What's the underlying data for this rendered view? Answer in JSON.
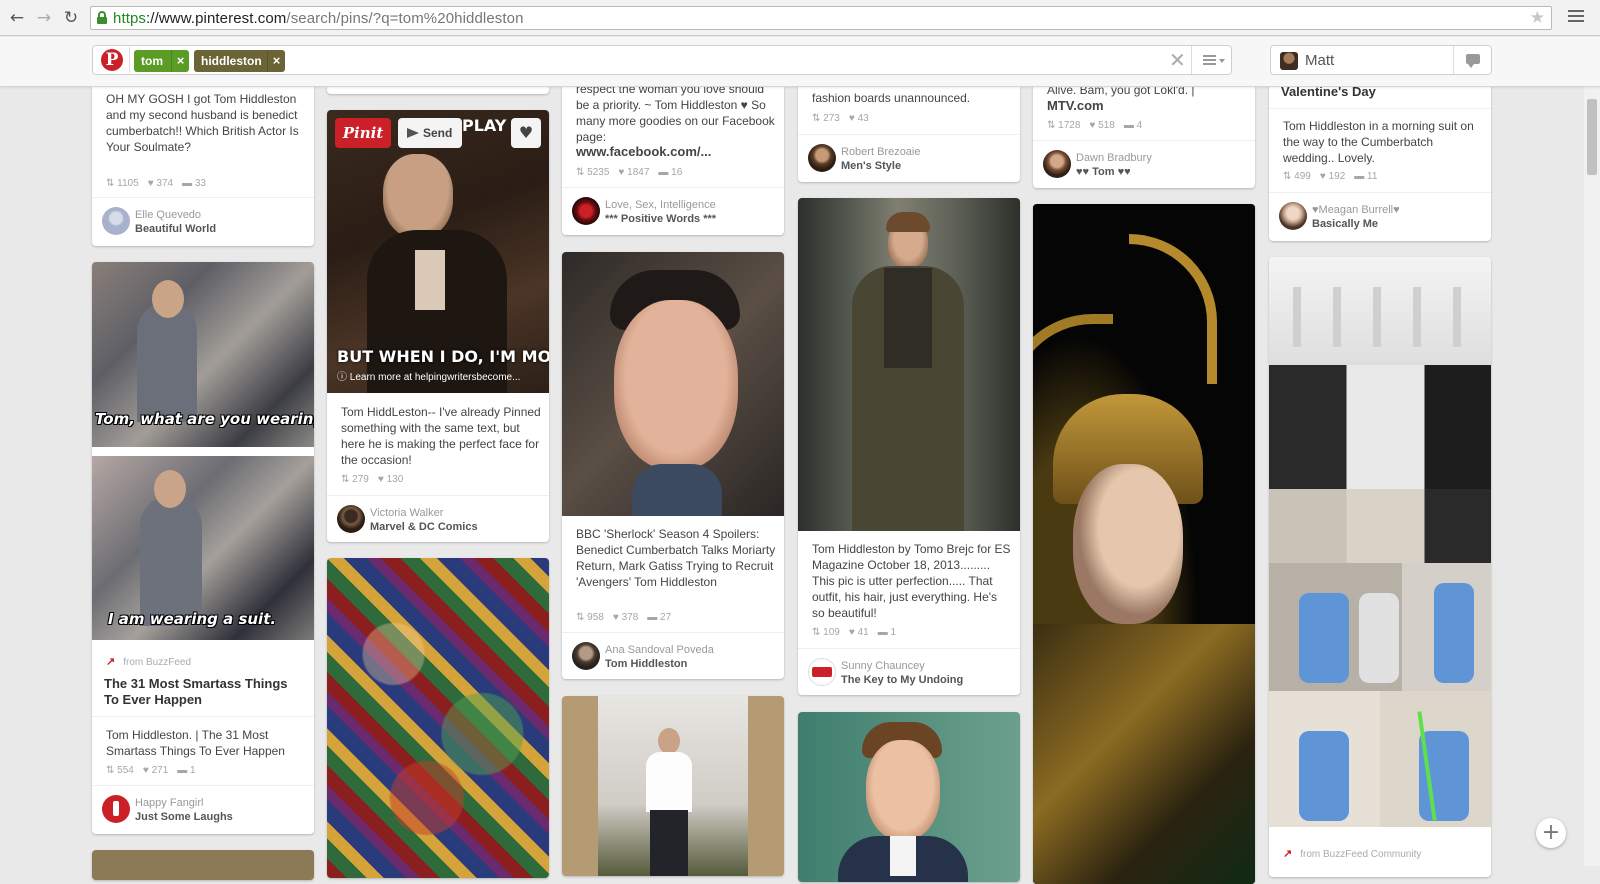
{
  "browser": {
    "url_scheme": "https",
    "url_host": "://www.pinterest.com",
    "url_path": "/search/pins/?q=tom%20hiddleston",
    "back_icon": "arrow-left-icon",
    "forward_icon": "arrow-right-icon",
    "reload_icon": "reload-icon"
  },
  "header": {
    "logo": "P",
    "tokens": [
      {
        "label": "tom",
        "color": "#5b9c26"
      },
      {
        "label": "hiddleston",
        "color": "#6b6436"
      }
    ],
    "token_remove": "×",
    "clear": "✕",
    "user_name": "Matt"
  },
  "pins": {
    "c1p1": {
      "desc": "OH MY GOSH I got Tom Hiddleston and my second husband is benedict cumberbatch!! Which British Actor Is Your Soulmate?",
      "repins": "1105",
      "likes": "374",
      "comments": "33",
      "by_name": "Elle Quevedo",
      "board": "Beautiful World"
    },
    "c1p2": {
      "caption1": "Tom, what are you wearing?",
      "caption2": "I am wearing a suit.",
      "source": "from BuzzFeed",
      "title": "The 31 Most Smartass Things To Ever Happen",
      "desc": "Tom Hiddleston. | The 31 Most Smartass Things To Ever Happen",
      "repins": "554",
      "likes": "271",
      "comments": "1",
      "by_name": "Happy Fangirl",
      "board": "Just Some Laughs"
    },
    "c2p1": {
      "pinit": "Pinit",
      "send": "Send",
      "top_text": "PLAY T",
      "bottom_text": "BUT WHEN I DO, I'M MORE",
      "overlay_link": "Learn more at helpingwritersbecome...",
      "desc": "Tom HiddLeston-- I've already Pinned something with the same text, but here he is making the perfect face for the occasion!",
      "repins": "279",
      "likes": "130",
      "by_name": "Victoria Walker",
      "board": "Marvel & DC Comics"
    },
    "c3p1": {
      "desc": "respect the woman you love should be a priority. ~ Tom Hiddleston ♥ So many more goodies on our Facebook page:",
      "link": "www.facebook.com/...",
      "repins": "5235",
      "likes": "1847",
      "comments": "16",
      "by_name": "Love, Sex, Intelligence",
      "board": "*** Positive Words ***"
    },
    "c3p2": {
      "desc": "BBC 'Sherlock' Season 4 Spoilers: Benedict Cumberbatch Talks Moriarty Return, Mark Gatiss Trying to Recruit 'Avengers' Tom Hiddleston",
      "repins": "958",
      "likes": "378",
      "comments": "27",
      "by_name": "Ana Sandoval Poveda",
      "board": "Tom Hiddleston"
    },
    "c4p1": {
      "desc": "fashion boards unannounced.",
      "repins": "273",
      "likes": "43",
      "by_name": "Robert Brezoaie",
      "board": "Men's Style"
    },
    "c4p2": {
      "desc": "Tom Hiddleston by Tomo Brejc for ES Magazine October 18, 2013......... This pic is utter perfection..... That outfit, his hair, just everything. He's so beautiful!",
      "repins": "109",
      "likes": "41",
      "comments": "1",
      "by_name": "Sunny Chauncey",
      "board": "The Key to My Undoing"
    },
    "c5p1": {
      "desc": "Alive. Bam, you got Lokl'd. |",
      "link": "MTV.com",
      "repins": "1728",
      "likes": "518",
      "comments": "4",
      "by_name": "Dawn Bradbury",
      "board": "♥♥ Tom ♥♥"
    },
    "c6p1": {
      "title": "Valentine's Day",
      "desc": "Tom Hiddleston in a morning suit on the way to the Cumberbatch wedding.. Lovely.",
      "repins": "499",
      "likes": "192",
      "comments": "11",
      "by_name": "♥Meagan Burrell♥",
      "board": "Basically Me"
    },
    "c6p2": {
      "source": "from BuzzFeed Community"
    }
  },
  "icons": {
    "repin": "repin-icon",
    "like": "heart-icon",
    "comment": "comment-icon"
  },
  "plus_label": "+"
}
